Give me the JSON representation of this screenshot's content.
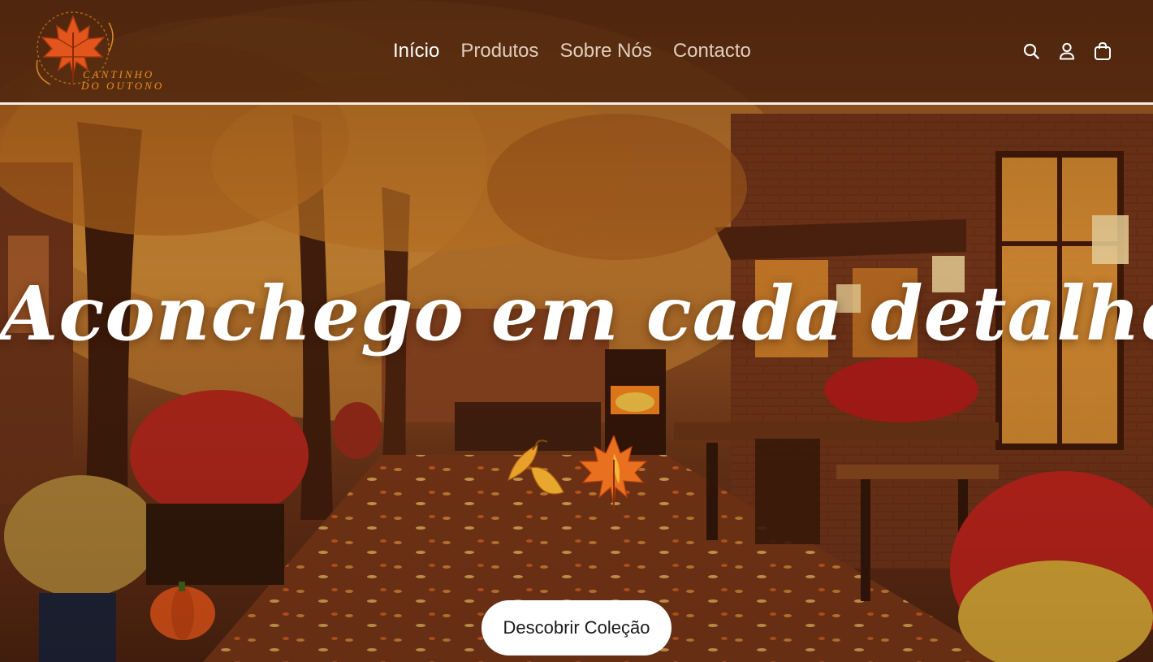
{
  "brand": {
    "line1": "CANTINHO",
    "line2": "DO OUTONO",
    "icon": "maple-leaf-logo"
  },
  "nav": {
    "items": [
      {
        "label": "Início",
        "active": true
      },
      {
        "label": "Produtos",
        "active": false
      },
      {
        "label": "Sobre Nós",
        "active": false
      },
      {
        "label": "Contacto",
        "active": false
      }
    ]
  },
  "header_icons": [
    "search-icon",
    "account-icon",
    "cart-icon"
  ],
  "hero": {
    "title": "Aconchego em cada detalhe",
    "cta_label": "Descobrir Coleção",
    "decoration": "autumn-leaves-icon"
  },
  "colors": {
    "header_bg": "#48220c",
    "accent_orange": "#e8901e",
    "leaf_red": "#e2561d",
    "text_white": "#ffffff",
    "nav_inactive": "#e3cdbd"
  }
}
